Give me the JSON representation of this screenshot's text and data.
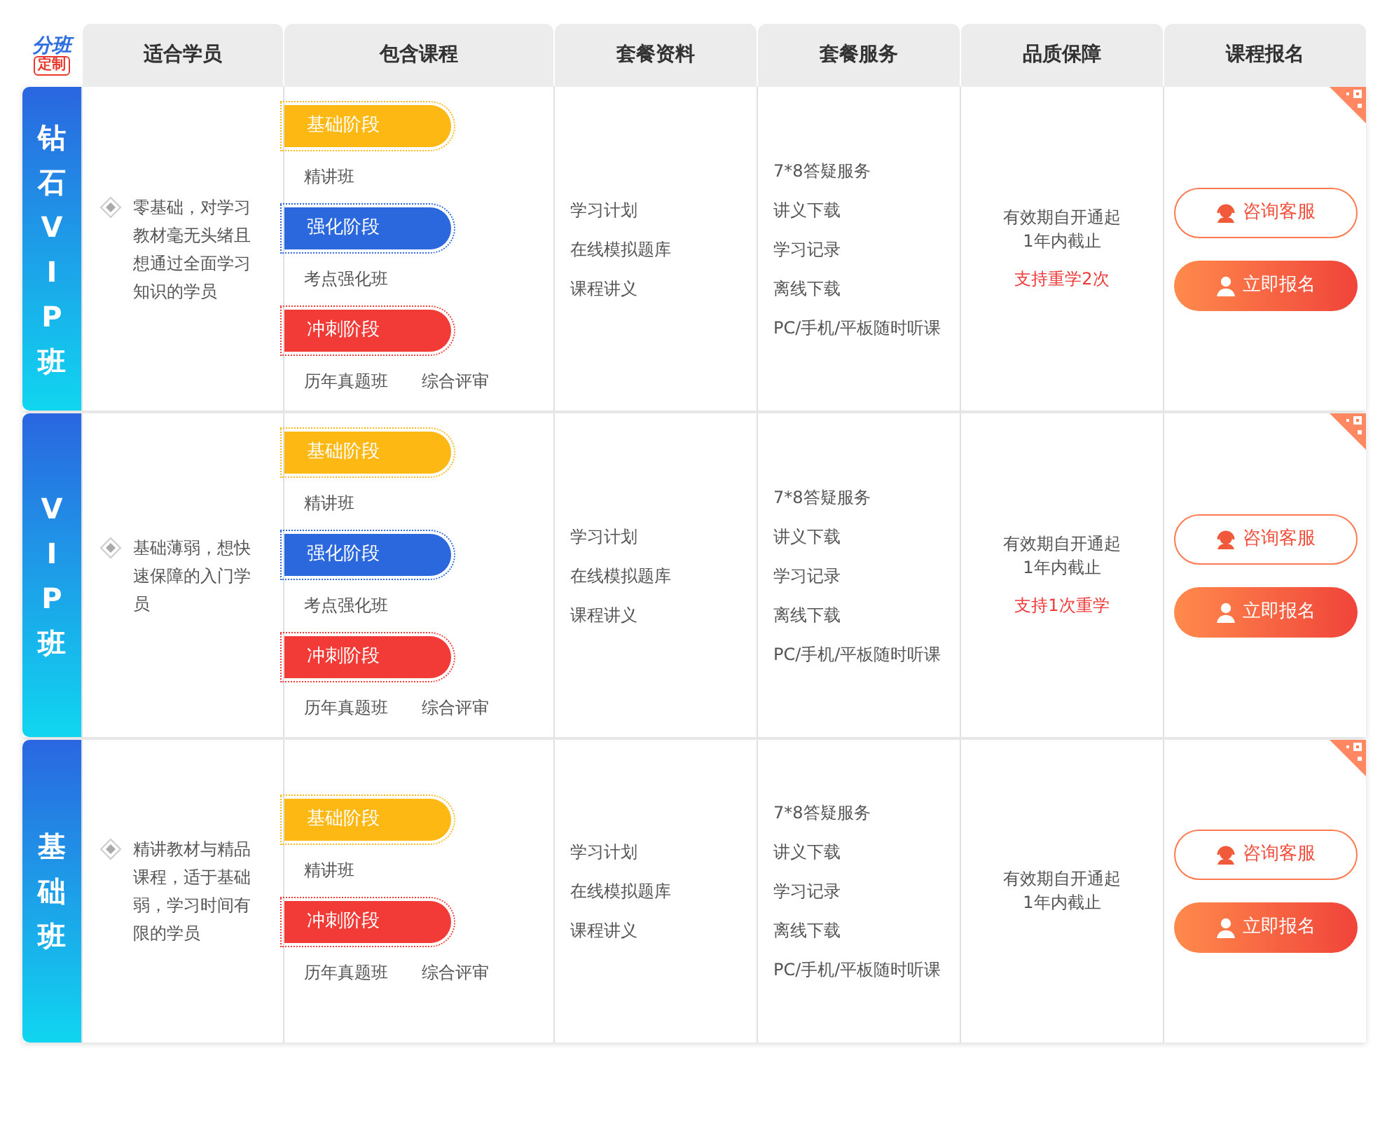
{
  "logo": {
    "line_1": "分班",
    "line_2": "定制"
  },
  "columns": [
    "适合学员",
    "包含课程",
    "套餐资料",
    "套餐服务",
    "品质保障",
    "课程报名"
  ],
  "tiers": [
    {
      "name": "钻石VIP班",
      "audience": "零基础，对学习教材毫无头绪且想通过全面学习知识的学员",
      "stages": [
        {
          "kind": "basic",
          "label": "基础阶段",
          "courses": [
            "精讲班"
          ]
        },
        {
          "kind": "intensive",
          "label": "强化阶段",
          "courses": [
            "考点强化班"
          ]
        },
        {
          "kind": "sprint",
          "label": "冲刺阶段",
          "courses": [
            "历年真题班",
            "综合评审"
          ]
        }
      ],
      "materials": [
        "学习计划",
        "在线模拟题库",
        "课程讲义"
      ],
      "services": [
        "7*8答疑服务",
        "讲义下载",
        "学习记录",
        "离线下载",
        "PC/手机/平板随时听课"
      ],
      "guarantee": [
        "有效期自开通起",
        "1年内截止"
      ],
      "highlight": "支持重学2次",
      "buttons": {
        "consult": "咨询客服",
        "enroll": "立即报名"
      }
    },
    {
      "name": "VIP班",
      "audience": "基础薄弱，想快速保障的入门学员",
      "stages": [
        {
          "kind": "basic",
          "label": "基础阶段",
          "courses": [
            "精讲班"
          ]
        },
        {
          "kind": "intensive",
          "label": "强化阶段",
          "courses": [
            "考点强化班"
          ]
        },
        {
          "kind": "sprint",
          "label": "冲刺阶段",
          "courses": [
            "历年真题班",
            "综合评审"
          ]
        }
      ],
      "materials": [
        "学习计划",
        "在线模拟题库",
        "课程讲义"
      ],
      "services": [
        "7*8答疑服务",
        "讲义下载",
        "学习记录",
        "离线下载",
        "PC/手机/平板随时听课"
      ],
      "guarantee": [
        "有效期自开通起",
        "1年内截止"
      ],
      "highlight": "支持1次重学",
      "buttons": {
        "consult": "咨询客服",
        "enroll": "立即报名"
      }
    },
    {
      "name": "基础班",
      "audience": "精讲教材与精品课程，适于基础弱，学习时间有限的学员",
      "stages": [
        {
          "kind": "basic",
          "label": "基础阶段",
          "courses": [
            "精讲班"
          ]
        },
        {
          "kind": "sprint",
          "label": "冲刺阶段",
          "courses": [
            "历年真题班",
            "综合评审"
          ]
        }
      ],
      "materials": [
        "学习计划",
        "在线模拟题库",
        "课程讲义"
      ],
      "services": [
        "7*8答疑服务",
        "讲义下载",
        "学习记录",
        "离线下载",
        "PC/手机/平板随时听课"
      ],
      "guarantee": [
        "有效期自开通起",
        "1年内截止"
      ],
      "buttons": {
        "consult": "咨询客服",
        "enroll": "立即报名"
      }
    }
  ]
}
